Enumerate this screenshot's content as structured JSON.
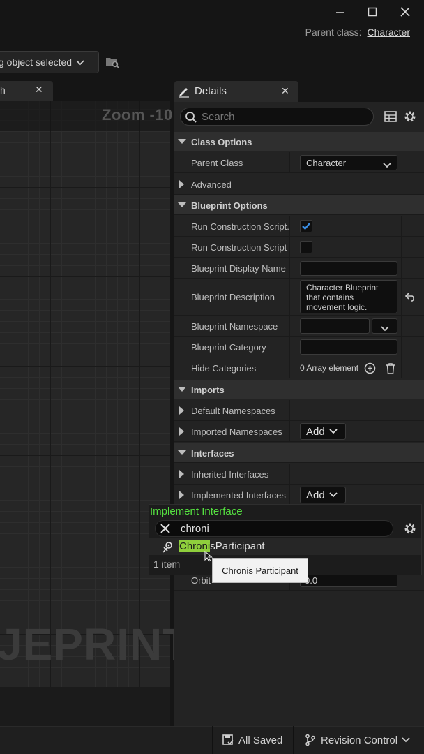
{
  "window": {
    "parent_class_label": "Parent class:",
    "parent_class_value": "Character"
  },
  "toolbar": {
    "debug_object": "g object selected"
  },
  "graph": {
    "tab_label": "h",
    "zoom": "Zoom -10",
    "watermark": "JEPRINT"
  },
  "details": {
    "tab_title": "Details",
    "search_placeholder": "Search",
    "categories": {
      "class_options": "Class Options",
      "blueprint_options": "Blueprint Options",
      "imports": "Imports",
      "interfaces": "Interfaces"
    },
    "rows": {
      "parent_class": {
        "name": "Parent Class",
        "value": "Character"
      },
      "advanced": {
        "name": "Advanced"
      },
      "run_cs_seq": {
        "name": "Run Construction Script...",
        "checked": true
      },
      "run_cs_in": {
        "name": "Run Construction Script i...",
        "checked": false
      },
      "display_name": {
        "name": "Blueprint Display Name",
        "value": ""
      },
      "description": {
        "name": "Blueprint Description",
        "value": "Character Blueprint that contains movement logic."
      },
      "namespace": {
        "name": "Blueprint Namespace",
        "value": ""
      },
      "category": {
        "name": "Blueprint Category",
        "value": ""
      },
      "hide_categories": {
        "name": "Hide Categories",
        "value": "0 Array element"
      },
      "default_namespaces": {
        "name": "Default Namespaces"
      },
      "imported_namespaces": {
        "name": "Imported Namespaces",
        "button": "Add"
      },
      "inherited_interfaces": {
        "name": "Inherited Interfaces"
      },
      "implemented_interfaces": {
        "name": "Implemented Interfaces",
        "button": "Add"
      },
      "orbit": {
        "name": "Orbit",
        "value": "0.0"
      }
    }
  },
  "popup": {
    "title": "Implement Interface",
    "search_value": "chroni",
    "item_match": "Chroni",
    "item_rest": "sParticipant",
    "count": "1 item",
    "tooltip": "Chronis Participant"
  },
  "status": {
    "saved": "All Saved",
    "revision": "Revision Control"
  },
  "colors": {
    "accent_check": "#3b8fe6",
    "popup_title": "#55e040",
    "highlight": "#8fcf3c"
  }
}
